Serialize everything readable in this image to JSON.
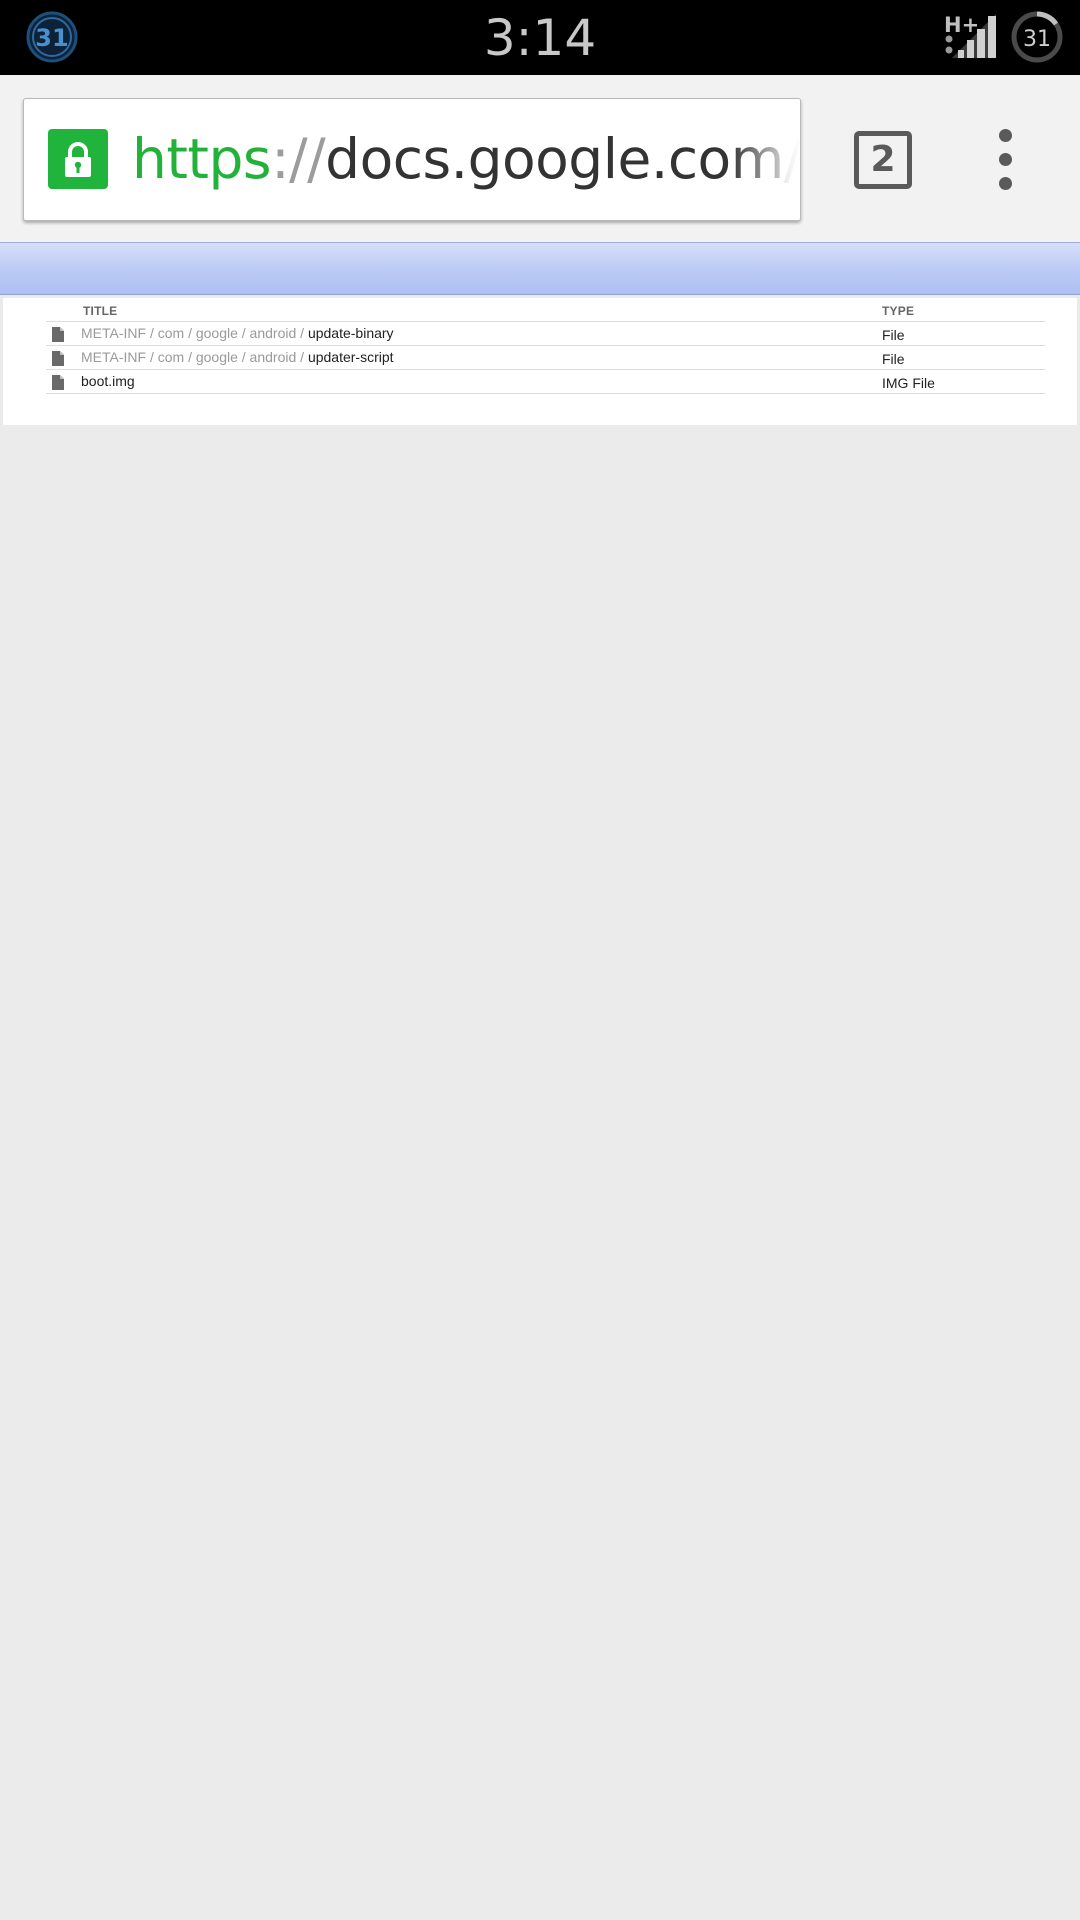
{
  "status_bar": {
    "left_badge": "31",
    "time": "3:14",
    "network_type": "H+",
    "right_badge": "31"
  },
  "toolbar": {
    "url_scheme": "https",
    "url_separator": "://",
    "url_host": "docs.google.com",
    "url_path": "/file/",
    "tab_count": "2"
  },
  "file_table": {
    "columns": [
      "TITLE",
      "TYPE"
    ],
    "rows": [
      {
        "path": "META-INF / com / google / android / ",
        "name": "update-binary",
        "type": "File"
      },
      {
        "path": "META-INF / com / google / android / ",
        "name": "updater-script",
        "type": "File"
      },
      {
        "path": "",
        "name": "boot.img",
        "type": "IMG File"
      }
    ]
  },
  "colors": {
    "status_bar_bg": "#000000",
    "toolbar_bg": "#f2f2f2",
    "secure_green": "#22b23a",
    "header_strip": "#bccbf5",
    "page_bg": "#ebebeb"
  },
  "icons": [
    "calendar-badge-icon",
    "network-signal-icon",
    "battery-ring-icon",
    "lock-icon",
    "tab-switcher-icon",
    "overflow-menu-icon",
    "file-icon"
  ]
}
